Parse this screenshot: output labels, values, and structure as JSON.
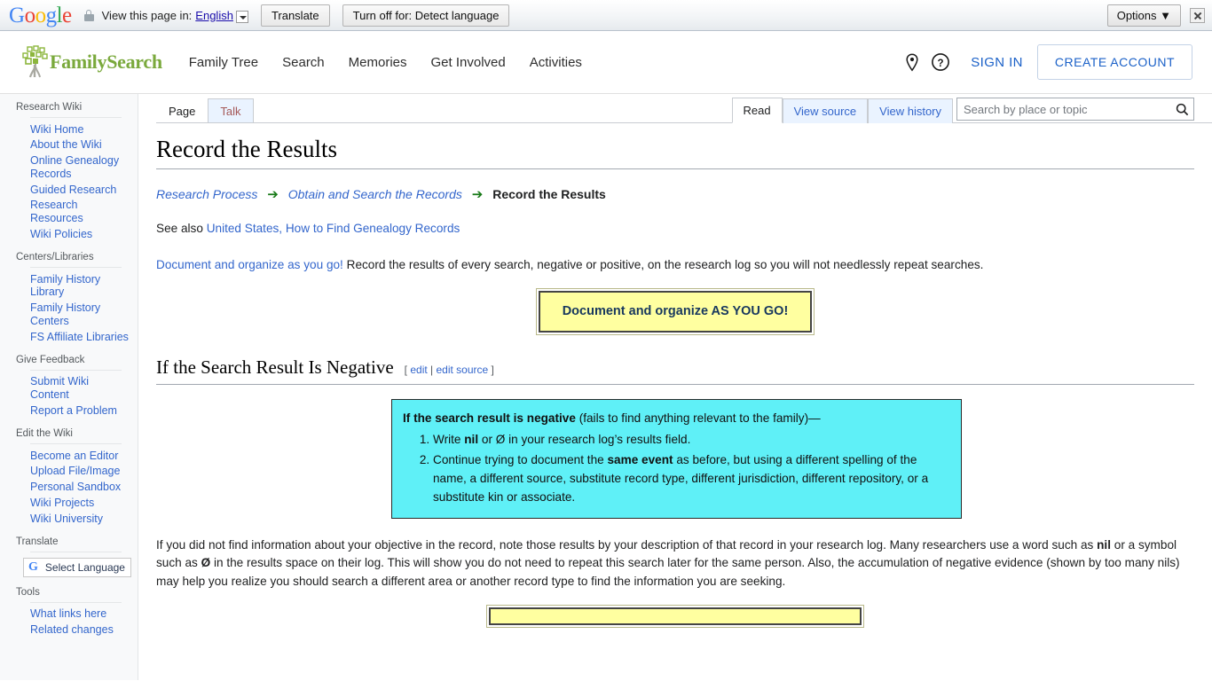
{
  "translate_bar": {
    "logo_letters": [
      "G",
      "o",
      "o",
      "g",
      "l",
      "e"
    ],
    "lock_icon": "lock-icon",
    "prompt": "View this page in:",
    "language": "English",
    "translate_label": "Translate",
    "turn_off_label": "Turn off for: Detect language",
    "options_label": "Options ▼",
    "close_icon": "close-icon"
  },
  "header": {
    "brand": "FamilySearch",
    "nav": [
      {
        "label": "Family Tree"
      },
      {
        "label": "Search"
      },
      {
        "label": "Memories"
      },
      {
        "label": "Get Involved"
      },
      {
        "label": "Activities"
      }
    ],
    "location_icon": "location-pin-icon",
    "help_icon": "help-circle-icon",
    "sign_in": "SIGN IN",
    "create_account": "CREATE ACCOUNT"
  },
  "sidebar": {
    "groups": [
      {
        "heading": "Research Wiki",
        "items": [
          {
            "label": "Wiki Home"
          },
          {
            "label": "About the Wiki"
          },
          {
            "label": "Online Genealogy Records"
          },
          {
            "label": "Guided Research"
          },
          {
            "label": "Research Resources"
          },
          {
            "label": "Wiki Policies"
          }
        ]
      },
      {
        "heading": "Centers/Libraries",
        "items": [
          {
            "label": "Family History Library"
          },
          {
            "label": "Family History Centers"
          },
          {
            "label": "FS Affiliate Libraries"
          }
        ]
      },
      {
        "heading": "Give Feedback",
        "items": [
          {
            "label": "Submit Wiki Content"
          },
          {
            "label": "Report a Problem"
          }
        ]
      },
      {
        "heading": "Edit the Wiki",
        "items": [
          {
            "label": "Become an Editor"
          },
          {
            "label": "Upload File/Image"
          },
          {
            "label": "Personal Sandbox"
          },
          {
            "label": "Wiki Projects"
          },
          {
            "label": "Wiki University"
          }
        ]
      },
      {
        "heading": "Translate",
        "items": []
      },
      {
        "heading": "Tools",
        "items": [
          {
            "label": "What links here"
          },
          {
            "label": "Related changes"
          }
        ]
      }
    ],
    "select_language": {
      "icon": "google-g-icon",
      "label": "Select Language"
    }
  },
  "tabs": {
    "namespace": [
      {
        "label": "Page",
        "selected": true
      },
      {
        "label": "Talk",
        "selected": false
      }
    ],
    "views": [
      {
        "label": "Read",
        "selected": true
      },
      {
        "label": "View source",
        "selected": false
      },
      {
        "label": "View history",
        "selected": false
      }
    ]
  },
  "search": {
    "placeholder": "Search by place or topic",
    "value": "",
    "icon": "search-icon"
  },
  "article": {
    "title": "Record the Results",
    "breadcrumb": {
      "first": "Research Process",
      "second": "Obtain and Search the Records",
      "current": "Record the Results",
      "separator": "➔"
    },
    "see_also_prefix": "See also ",
    "see_also_link": "United States, How to Find Genealogy Records",
    "intro_link": "Document and organize as you go!",
    "intro_rest": " Record the results of every search, negative or positive, on the research log so you will not needlessly repeat searches.",
    "callout_yellow": "Document and organize AS YOU GO!",
    "section": {
      "heading": "If the Search Result Is Negative",
      "edit_open": "[ ",
      "edit": "edit",
      "edit_pipe": " | ",
      "edit_source": "edit source",
      "edit_close": " ]"
    },
    "cyan_box": {
      "lead_bold": "If the search result is negative",
      "lead_rest": " (fails to find anything relevant to the family)—",
      "item1_a": "Write ",
      "item1_bold": "nil",
      "item1_b": " or Ø in your research log’s results field.",
      "item2_a": "Continue trying to document the ",
      "item2_bold": "same event",
      "item2_b": " as before, but using a different spelling of the name, a different source, substitute record type, different jurisdiction, different repository, or a substitute kin or associate."
    },
    "closing_a": "If you did not find information about your objective in the record, note those results by your description of that record in your research log. Many researchers use a word such as ",
    "closing_bold1": "nil",
    "closing_b": " or a symbol such as ",
    "closing_bold2": "Ø",
    "closing_c": " in the results space on their log. This will show you do not need to repeat this search later for the same person. Also, the accumulation of negative evidence (shown by too many nils) may help you realize you should search a different area or another record type to find the information you are seeking."
  },
  "colors": {
    "brand_green": "#7aa93c",
    "link_blue": "#3366cc",
    "fs_blue": "#1b61c8",
    "callout_yellow_bg": "#ffffa0",
    "callout_yellow_text": "#17375e",
    "cyan_bg": "#5ff0f7",
    "arrow_green": "#187a18"
  }
}
